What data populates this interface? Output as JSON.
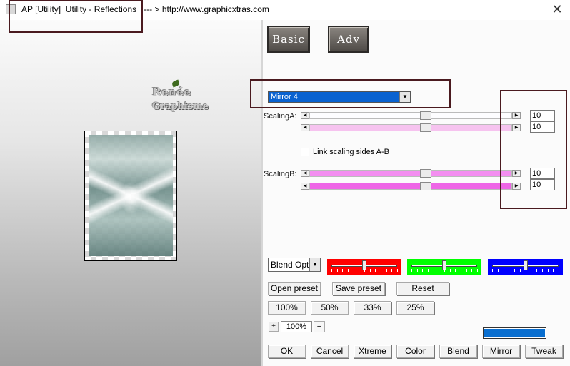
{
  "window": {
    "title": "AP [Utility]  Utility - Reflections   --- > http://www.graphicxtras.com",
    "close_icon": "close-icon"
  },
  "watermark": {
    "line1": "Renée",
    "line2": "Graphisme"
  },
  "tabs": {
    "basic_label": "Basic",
    "adv_label": "Adv"
  },
  "mode_select": {
    "value": "Mirror 4"
  },
  "scaling_a": {
    "label": "ScalingA:",
    "value1": "10",
    "value2": "10",
    "level1": 0.58,
    "level2": 0.58
  },
  "link_checkbox": {
    "label": "Link scaling sides A-B",
    "checked": false
  },
  "scaling_b": {
    "label": "ScalingB:",
    "value1": "10",
    "value2": "10",
    "level1": 0.58,
    "level2": 0.58
  },
  "blend_select": {
    "value": "Blend Options"
  },
  "color_sliders": [
    {
      "name": "red",
      "color": "#ff0000",
      "level": 0.5
    },
    {
      "name": "green",
      "color": "#00ff00",
      "level": 0.5
    },
    {
      "name": "blue",
      "color": "#0000ff",
      "level": 0.5
    }
  ],
  "preset_buttons": {
    "open": "Open preset",
    "save": "Save preset",
    "reset": "Reset"
  },
  "zoom_buttons": [
    "100%",
    "50%",
    "33%",
    "25%"
  ],
  "zoom": {
    "plus": "+",
    "value": "100%",
    "minus": "−"
  },
  "swatch_color": "#0a6fd0",
  "action_buttons": [
    "OK",
    "Cancel",
    "Xtreme",
    "Color",
    "Blend",
    "Mirror",
    "Tweak"
  ],
  "colors": {
    "highlight_border": "#4a1a1f",
    "select_blue": "#0a62d0",
    "scaling_a_track1": "#fdfdff",
    "scaling_a_track2": "#f6c3ef",
    "scaling_b_track1": "#f38ef0",
    "scaling_b_track2": "#ee66e6"
  }
}
